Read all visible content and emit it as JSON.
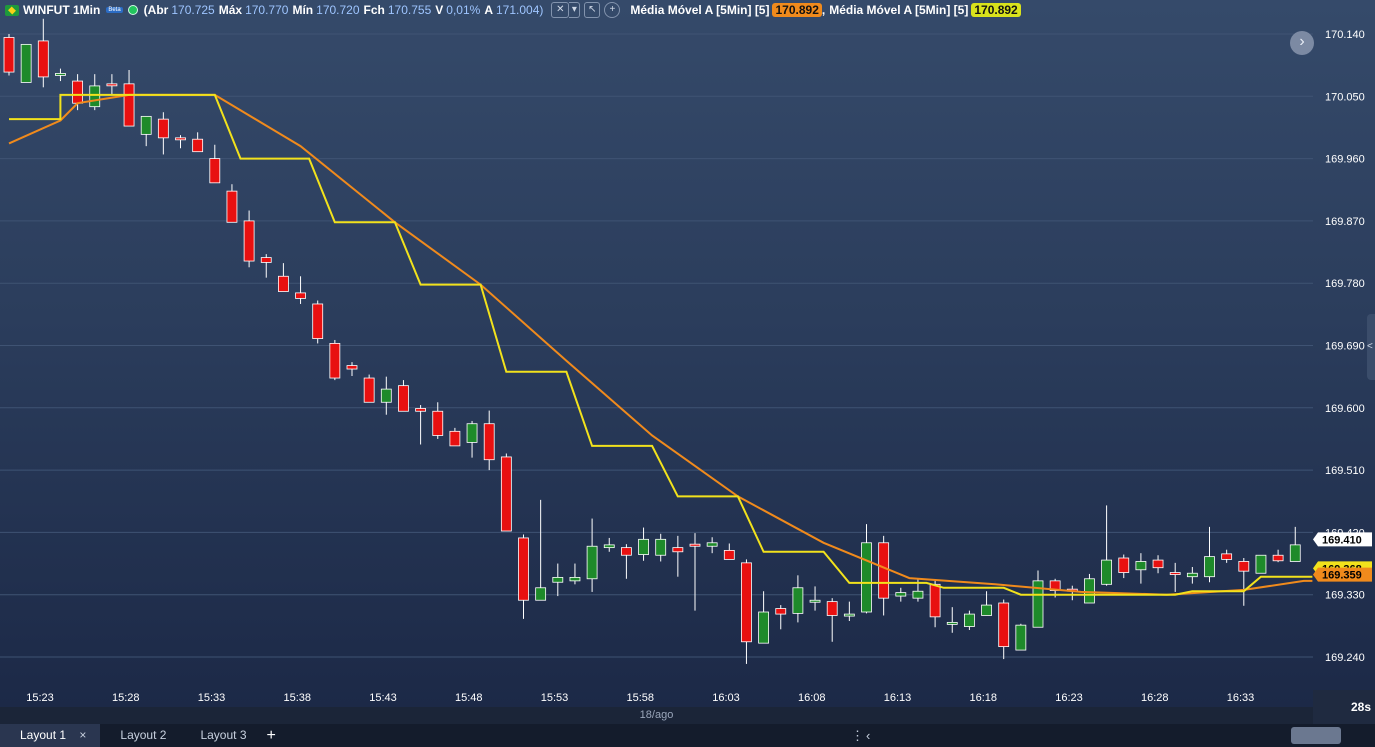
{
  "header": {
    "symbol": "WINFUT 1Min",
    "mini_badge": "Beta",
    "open_label": "(Abr",
    "open_value": "170.725",
    "high_label": "Máx",
    "high_value": "170.770",
    "low_label": "Mín",
    "low_value": "170.720",
    "close_label": "Fch",
    "close_value": "170.755",
    "var_label": "V",
    "var_value": "0,01%",
    "prev_label": "A",
    "prev_value": "171.004)",
    "ma1_label": "Média Móvel A [5Min] [5]",
    "ma1_value": "170.892",
    "ma2_label": "Média Móvel A [5Min] [5]",
    "ma2_value": "170.892",
    "tool_icons": [
      "crosshair-icon",
      "dropdown-icon",
      "cursor-icon",
      "plus-icon"
    ]
  },
  "colors": {
    "up": "#1e8a2a",
    "down": "#e81010",
    "ma_fast": "#f2e21c",
    "ma_slow": "#f08a1c",
    "last_price_bg": "#ffffff",
    "ma_fast_bg": "#f2e21c",
    "ma_slow_bg": "#f08a1c"
  },
  "chart_data": {
    "type": "candlestick",
    "yaxis_ticks": [
      "170.140",
      "170.050",
      "169.960",
      "169.870",
      "169.780",
      "169.690",
      "169.600",
      "169.510",
      "169.420",
      "169.330",
      "169.240"
    ],
    "xaxis_ticks": [
      "15:23",
      "15:28",
      "15:33",
      "15:38",
      "15:43",
      "15:48",
      "15:53",
      "15:58",
      "16:03",
      "16:08",
      "16:13",
      "16:18",
      "16:23",
      "16:28",
      "16:33"
    ],
    "ylim": [
      169.192,
      170.176
    ],
    "x_start_minute": "15:23",
    "date_label": "18/ago",
    "last_price": "169.410",
    "ma_fast_last": "169.368",
    "ma_slow_last": "169.359",
    "candles": [
      {
        "o": 170.135,
        "h": 170.14,
        "l": 170.08,
        "c": 170.085
      },
      {
        "o": 170.07,
        "h": 170.11,
        "l": 170.07,
        "c": 170.125
      },
      {
        "o": 170.13,
        "h": 170.162,
        "l": 170.063,
        "c": 170.078
      },
      {
        "o": 170.081,
        "h": 170.09,
        "l": 170.072,
        "c": 170.083
      },
      {
        "o": 170.072,
        "h": 170.082,
        "l": 170.03,
        "c": 170.04
      },
      {
        "o": 170.035,
        "h": 170.082,
        "l": 170.03,
        "c": 170.065
      },
      {
        "o": 170.068,
        "h": 170.082,
        "l": 170.053,
        "c": 170.067
      },
      {
        "o": 170.068,
        "h": 170.088,
        "l": 170.047,
        "c": 170.007
      },
      {
        "o": 169.995,
        "h": 170.017,
        "l": 169.978,
        "c": 170.021
      },
      {
        "o": 170.017,
        "h": 170.027,
        "l": 169.966,
        "c": 169.99
      },
      {
        "o": 169.99,
        "h": 169.994,
        "l": 169.975,
        "c": 169.988
      },
      {
        "o": 169.988,
        "h": 169.998,
        "l": 169.973,
        "c": 169.97
      },
      {
        "o": 169.96,
        "h": 169.98,
        "l": 169.925,
        "c": 169.925
      },
      {
        "o": 169.913,
        "h": 169.923,
        "l": 169.868,
        "c": 169.868
      },
      {
        "o": 169.87,
        "h": 169.885,
        "l": 169.803,
        "c": 169.812
      },
      {
        "o": 169.817,
        "h": 169.822,
        "l": 169.788,
        "c": 169.81
      },
      {
        "o": 169.79,
        "h": 169.809,
        "l": 169.777,
        "c": 169.768
      },
      {
        "o": 169.766,
        "h": 169.79,
        "l": 169.75,
        "c": 169.758
      },
      {
        "o": 169.75,
        "h": 169.755,
        "l": 169.693,
        "c": 169.7
      },
      {
        "o": 169.693,
        "h": 169.698,
        "l": 169.64,
        "c": 169.643
      },
      {
        "o": 169.661,
        "h": 169.666,
        "l": 169.646,
        "c": 169.656
      },
      {
        "o": 169.643,
        "h": 169.648,
        "l": 169.621,
        "c": 169.608
      },
      {
        "o": 169.608,
        "h": 169.645,
        "l": 169.59,
        "c": 169.627
      },
      {
        "o": 169.632,
        "h": 169.64,
        "l": 169.595,
        "c": 169.595
      },
      {
        "o": 169.599,
        "h": 169.604,
        "l": 169.547,
        "c": 169.595
      },
      {
        "o": 169.595,
        "h": 169.608,
        "l": 169.555,
        "c": 169.56
      },
      {
        "o": 169.566,
        "h": 169.571,
        "l": 169.545,
        "c": 169.545
      },
      {
        "o": 169.55,
        "h": 169.581,
        "l": 169.528,
        "c": 169.577
      },
      {
        "o": 169.577,
        "h": 169.596,
        "l": 169.51,
        "c": 169.525
      },
      {
        "o": 169.529,
        "h": 169.534,
        "l": 169.463,
        "c": 169.422
      },
      {
        "o": 169.412,
        "h": 169.417,
        "l": 169.295,
        "c": 169.322
      },
      {
        "o": 169.322,
        "h": 169.467,
        "l": 169.322,
        "c": 169.34
      },
      {
        "o": 169.348,
        "h": 169.375,
        "l": 169.328,
        "c": 169.355
      },
      {
        "o": 169.35,
        "h": 169.375,
        "l": 169.345,
        "c": 169.355
      },
      {
        "o": 169.353,
        "h": 169.44,
        "l": 169.334,
        "c": 169.4
      },
      {
        "o": 169.398,
        "h": 169.412,
        "l": 169.392,
        "c": 169.402
      },
      {
        "o": 169.398,
        "h": 169.403,
        "l": 169.353,
        "c": 169.387
      },
      {
        "o": 169.388,
        "h": 169.427,
        "l": 169.379,
        "c": 169.41
      },
      {
        "o": 169.387,
        "h": 169.418,
        "l": 169.378,
        "c": 169.41
      },
      {
        "o": 169.398,
        "h": 169.415,
        "l": 169.356,
        "c": 169.392
      },
      {
        "o": 169.403,
        "h": 169.419,
        "l": 169.307,
        "c": 169.4
      },
      {
        "o": 169.4,
        "h": 169.413,
        "l": 169.39,
        "c": 169.405
      },
      {
        "o": 169.394,
        "h": 169.404,
        "l": 169.381,
        "c": 169.381
      },
      {
        "o": 169.376,
        "h": 169.381,
        "l": 169.23,
        "c": 169.262
      },
      {
        "o": 169.26,
        "h": 169.335,
        "l": 169.26,
        "c": 169.305
      },
      {
        "o": 169.31,
        "h": 169.315,
        "l": 169.28,
        "c": 169.302
      },
      {
        "o": 169.303,
        "h": 169.358,
        "l": 169.29,
        "c": 169.34
      },
      {
        "o": 169.322,
        "h": 169.342,
        "l": 169.307,
        "c": 169.322
      },
      {
        "o": 169.32,
        "h": 169.325,
        "l": 169.262,
        "c": 169.3
      },
      {
        "o": 169.3,
        "h": 169.32,
        "l": 169.292,
        "c": 169.302
      },
      {
        "o": 169.305,
        "h": 169.432,
        "l": 169.303,
        "c": 169.405
      },
      {
        "o": 169.405,
        "h": 169.415,
        "l": 169.3,
        "c": 169.325
      },
      {
        "o": 169.328,
        "h": 169.34,
        "l": 169.32,
        "c": 169.333
      },
      {
        "o": 169.325,
        "h": 169.352,
        "l": 169.32,
        "c": 169.335
      },
      {
        "o": 169.345,
        "h": 169.35,
        "l": 169.283,
        "c": 169.298
      },
      {
        "o": 169.29,
        "h": 169.312,
        "l": 169.275,
        "c": 169.29
      },
      {
        "o": 169.284,
        "h": 169.307,
        "l": 169.279,
        "c": 169.302
      },
      {
        "o": 169.3,
        "h": 169.335,
        "l": 169.3,
        "c": 169.315
      },
      {
        "o": 169.318,
        "h": 169.323,
        "l": 169.237,
        "c": 169.255
      },
      {
        "o": 169.25,
        "h": 169.288,
        "l": 169.25,
        "c": 169.286
      },
      {
        "o": 169.283,
        "h": 169.365,
        "l": 169.283,
        "c": 169.35
      },
      {
        "o": 169.35,
        "h": 169.353,
        "l": 169.326,
        "c": 169.336
      },
      {
        "o": 169.338,
        "h": 169.343,
        "l": 169.322,
        "c": 169.336
      },
      {
        "o": 169.318,
        "h": 169.36,
        "l": 169.318,
        "c": 169.353
      },
      {
        "o": 169.345,
        "h": 169.459,
        "l": 169.343,
        "c": 169.38
      },
      {
        "o": 169.383,
        "h": 169.388,
        "l": 169.354,
        "c": 169.362
      },
      {
        "o": 169.366,
        "h": 169.39,
        "l": 169.346,
        "c": 169.378
      },
      {
        "o": 169.38,
        "h": 169.387,
        "l": 169.361,
        "c": 169.369
      },
      {
        "o": 169.362,
        "h": 169.376,
        "l": 169.334,
        "c": 169.36
      },
      {
        "o": 169.356,
        "h": 169.37,
        "l": 169.346,
        "c": 169.361
      },
      {
        "o": 169.356,
        "h": 169.428,
        "l": 169.348,
        "c": 169.385
      },
      {
        "o": 169.389,
        "h": 169.395,
        "l": 169.376,
        "c": 169.381
      },
      {
        "o": 169.378,
        "h": 169.383,
        "l": 169.314,
        "c": 169.364
      },
      {
        "o": 169.361,
        "h": 169.387,
        "l": 169.361,
        "c": 169.387
      },
      {
        "o": 169.387,
        "h": 169.395,
        "l": 169.377,
        "c": 169.379
      },
      {
        "o": 169.378,
        "h": 169.428,
        "l": 169.378,
        "c": 169.402
      }
    ],
    "ma_fast": [
      [
        0,
        170.017
      ],
      [
        3,
        170.017
      ],
      [
        3,
        170.052
      ],
      [
        12,
        170.052
      ],
      [
        13.5,
        169.96
      ],
      [
        17.5,
        169.96
      ],
      [
        19,
        169.868
      ],
      [
        22.5,
        169.868
      ],
      [
        24,
        169.778
      ],
      [
        27.5,
        169.778
      ],
      [
        29,
        169.652
      ],
      [
        32.5,
        169.652
      ],
      [
        34,
        169.545
      ],
      [
        37.5,
        169.545
      ],
      [
        39,
        169.472
      ],
      [
        42.5,
        169.472
      ],
      [
        44,
        169.392
      ],
      [
        47.5,
        169.392
      ],
      [
        49,
        169.347
      ],
      [
        53.5,
        169.347
      ],
      [
        54.5,
        169.34
      ],
      [
        58,
        169.34
      ],
      [
        59,
        169.33
      ],
      [
        68,
        169.33
      ],
      [
        69,
        169.335
      ],
      [
        72,
        169.335
      ],
      [
        73,
        169.356
      ],
      [
        76,
        169.356
      ]
    ],
    "ma_slow": [
      [
        0,
        169.982
      ],
      [
        3,
        170.015
      ],
      [
        4,
        170.04
      ],
      [
        7,
        170.052
      ],
      [
        12,
        170.052
      ],
      [
        17,
        169.978
      ],
      [
        22.5,
        169.868
      ],
      [
        27.5,
        169.778
      ],
      [
        32.5,
        169.668
      ],
      [
        37.5,
        169.56
      ],
      [
        42.5,
        169.472
      ],
      [
        47.5,
        169.405
      ],
      [
        52.5,
        169.354
      ],
      [
        57.5,
        169.345
      ],
      [
        62.5,
        169.334
      ],
      [
        67.5,
        169.33
      ],
      [
        72,
        169.337
      ],
      [
        75.5,
        169.35
      ],
      [
        76,
        169.35
      ]
    ]
  },
  "side_handle_glyph": "<",
  "scroll_button_glyph": "›",
  "timer": "28s",
  "tabs": [
    {
      "label": "Layout 1",
      "close": "×"
    },
    {
      "label": "Layout 2"
    },
    {
      "label": "Layout 3"
    }
  ],
  "tab_add": "+",
  "tab_menu_glyph": "⋮",
  "tab_left_glyph": "‹"
}
